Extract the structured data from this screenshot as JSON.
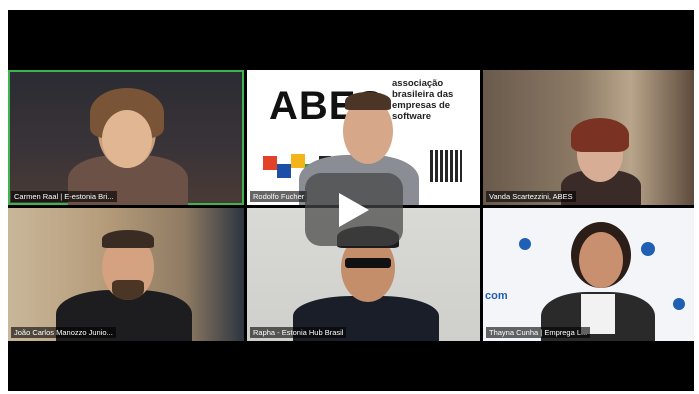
{
  "participants": [
    {
      "name": "Carmen Raal | E-estonia Bri...",
      "active": true
    },
    {
      "name": "Rodolfo Fucher",
      "active": false
    },
    {
      "name": "Vanda Scartezzini, ABES",
      "active": false
    },
    {
      "name": "João Carlos Manozzo Junio...",
      "active": false
    },
    {
      "name": "Rapha - Estonia Hub Brasil",
      "active": false
    },
    {
      "name": "Thayna Cunha | Emprega L...",
      "active": false
    }
  ],
  "abes_slide": {
    "logo": "ABES",
    "text": "associação brasileira das empresas de software"
  },
  "blue_slide": {
    "text": "com"
  },
  "colors": {
    "active_border": "#3fb34f",
    "accent_blue": "#1f5fb4"
  },
  "overlay": {
    "icon": "play-icon"
  }
}
